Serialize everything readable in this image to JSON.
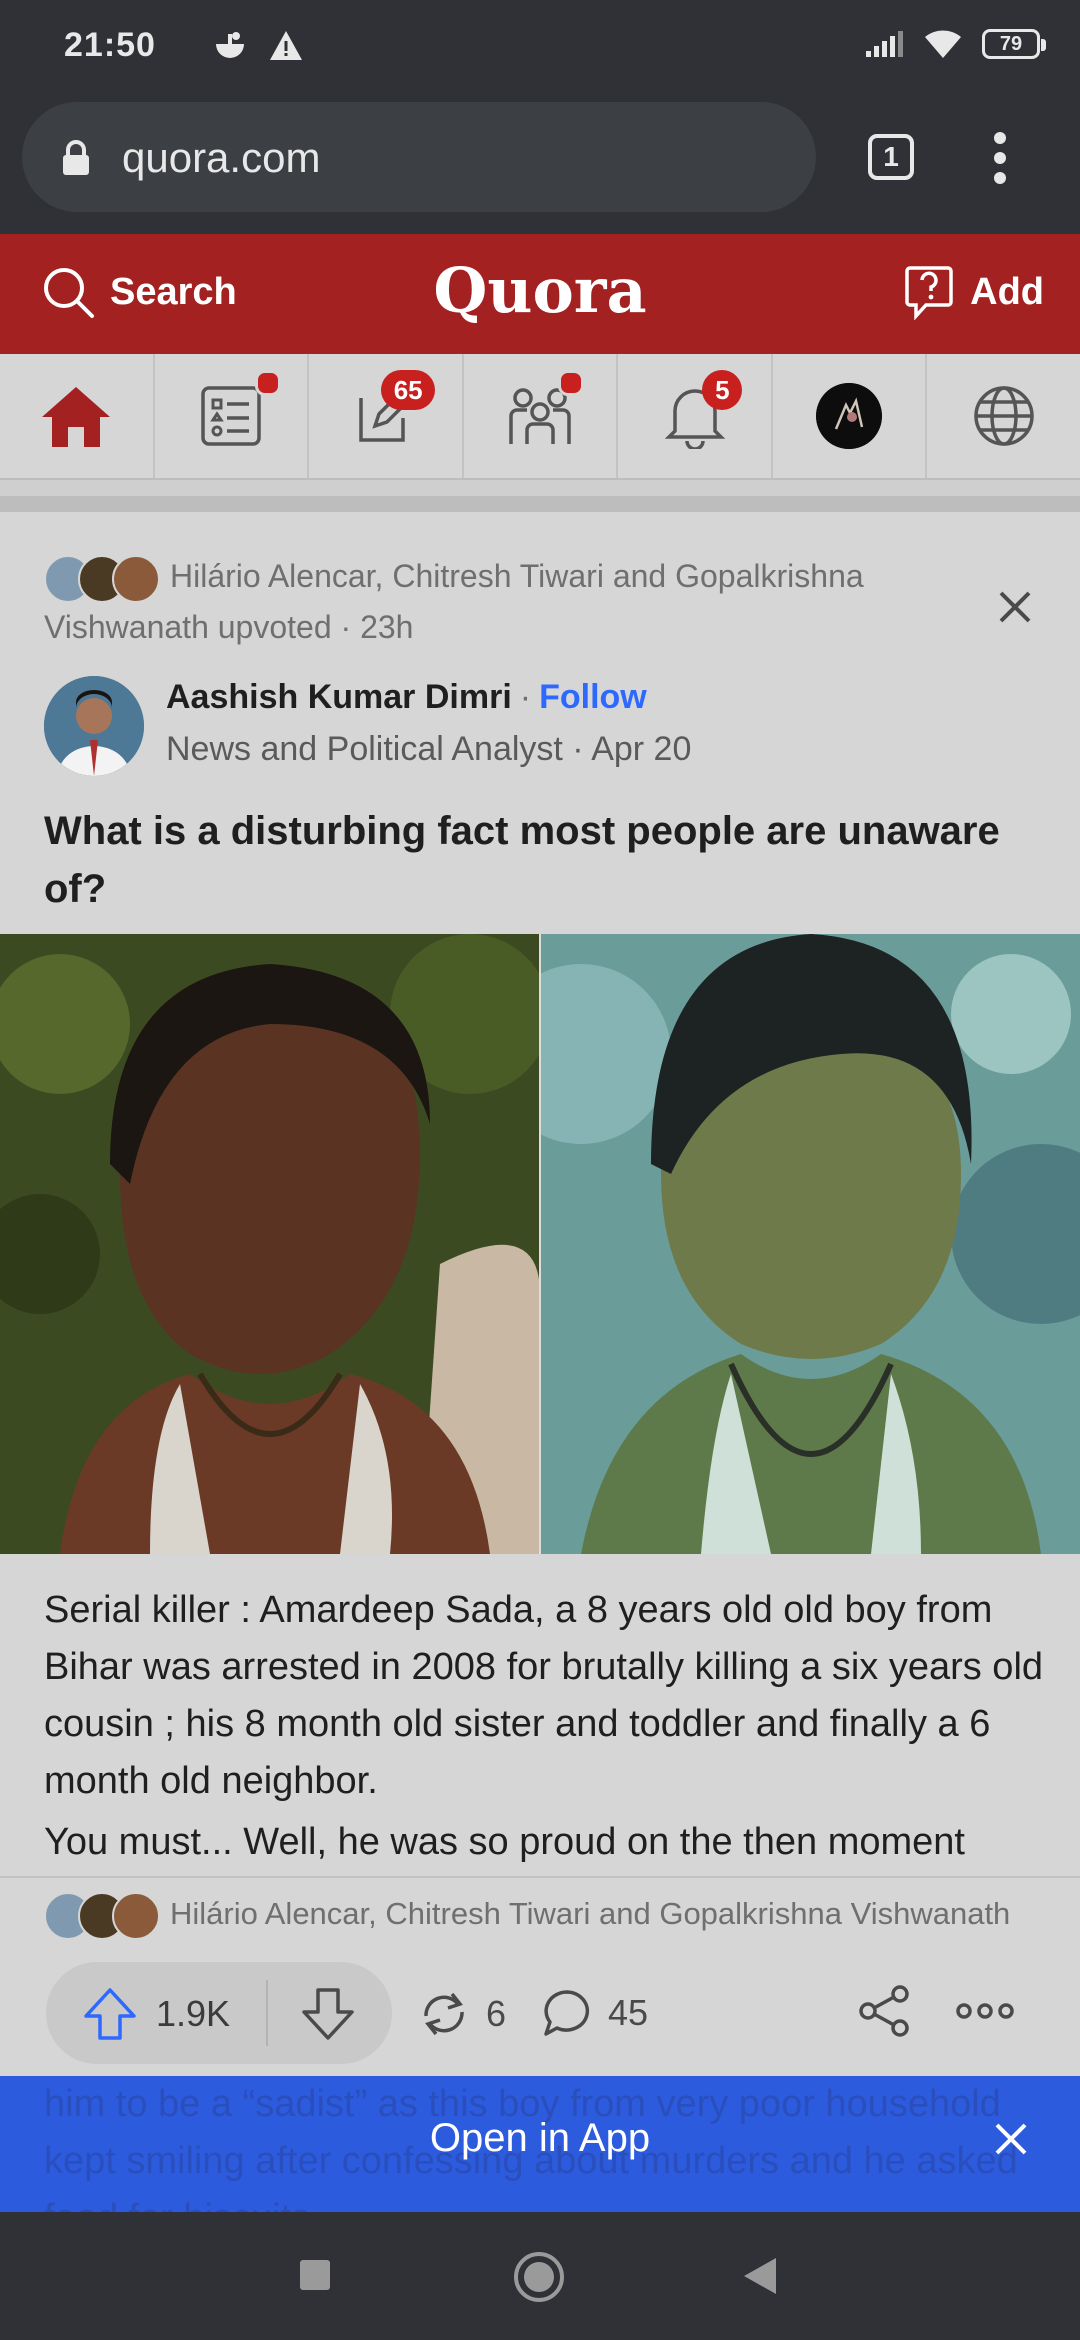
{
  "status_bar": {
    "time": "21:50",
    "battery": "79"
  },
  "browser": {
    "url": "quora.com",
    "tab_count": "1"
  },
  "header": {
    "search_label": "Search",
    "logo": "Quora",
    "add_label": "Add"
  },
  "nav": {
    "answer_badge": "65",
    "notifications_badge": "5"
  },
  "post": {
    "upvoters_text": "Hilário Alencar, Chitresh Tiwari and Gopalkrishna Vishwanath upvoted · 23h",
    "author_name": "Aashish Kumar Dimri",
    "separator": "·",
    "follow_label": "Follow",
    "author_credential": "News and Political Analyst · Apr 20",
    "question": "What is a disturbing fact most people are unaware of?",
    "answer_text": "Serial killer : Amardeep Sada, a 8 years old old boy from Bihar was arrested in 2008 for brutally killing a six years old cousin ; his 8 month old sister and toddler and finally a 6 month old neighbor.",
    "answer_continued": "You must... Well, he was so proud on the then moment"
  },
  "action_bar": {
    "upvoters_text": "Hilário Alencar, Chitresh Tiwari and Gopalkrishna Vishwanath",
    "upvotes": "1.9K",
    "shares": "6",
    "comments": "45"
  },
  "open_app": {
    "label": "Open in App",
    "behind_text": "him to be a “sadist” as this boy from very poor household kept smiling after confessing about murders and he asked food for biscuits."
  },
  "colors": {
    "quora_red": "#a32120",
    "badge_red": "#c8201f",
    "follow_blue": "#2e69ff",
    "open_app_blue": "#2d5bde",
    "chrome_dark": "#2f3136"
  },
  "icons": [
    "lock-icon",
    "search-icon",
    "add-question-icon",
    "home-icon",
    "feed-list-icon",
    "answer-edit-icon",
    "spaces-icon",
    "bell-icon",
    "globe-icon",
    "close-icon",
    "upvote-icon",
    "downvote-icon",
    "share-rotate-icon",
    "comment-icon",
    "share-icon",
    "more-icon",
    "square-nav-icon",
    "circle-nav-icon",
    "back-nav-icon"
  ]
}
